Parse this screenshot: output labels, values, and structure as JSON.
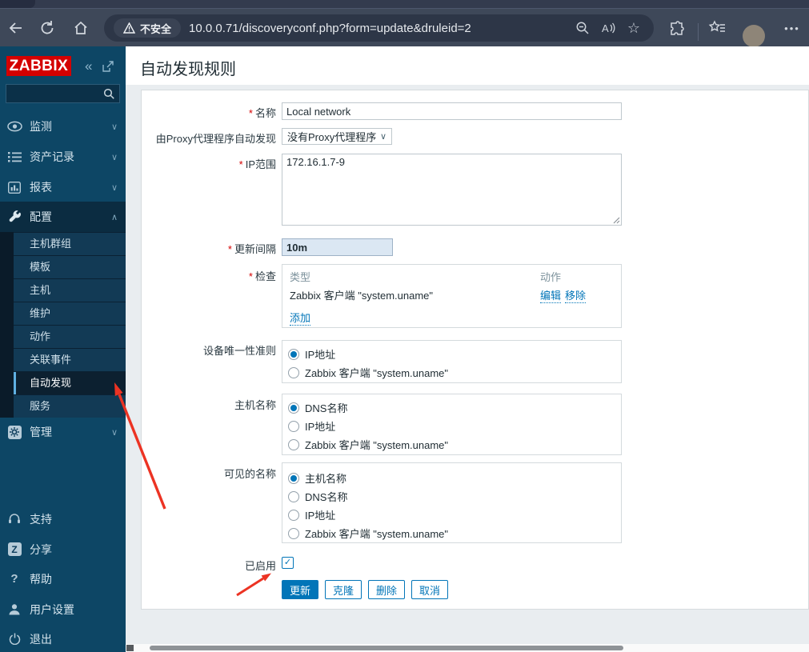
{
  "browser": {
    "security_badge": "不安全",
    "url": "10.0.0.71/discoveryconf.php?form=update&druleid=2"
  },
  "sidebar": {
    "logo": "ZABBIX",
    "menu": [
      {
        "label": "监测"
      },
      {
        "label": "资产记录"
      },
      {
        "label": "报表"
      },
      {
        "label": "配置"
      }
    ],
    "submenu": [
      "主机群组",
      "模板",
      "主机",
      "维护",
      "动作",
      "关联事件",
      "自动发现",
      "服务"
    ],
    "selected_submenu": "自动发现",
    "admin_label": "管理",
    "footer": [
      "支持",
      "分享",
      "帮助",
      "用户设置",
      "退出"
    ]
  },
  "page": {
    "title": "自动发现规则",
    "form": {
      "name": {
        "label": "名称",
        "value": "Local network",
        "required": true
      },
      "proxy": {
        "label": "由Proxy代理程序自动发现",
        "value": "没有Proxy代理程序"
      },
      "ip_range": {
        "label": "IP范围",
        "value": "172.16.1.7-9",
        "required": true
      },
      "interval": {
        "label": "更新间隔",
        "value": "10m",
        "required": true
      },
      "checks": {
        "label": "检查",
        "required": true,
        "type_header": "类型",
        "action_header": "动作",
        "row": "Zabbix 客户端 \"system.uname\"",
        "edit": "编辑",
        "remove": "移除",
        "add": "添加"
      },
      "uniqueness": {
        "label": "设备唯一性准则",
        "options": [
          {
            "label": "IP地址",
            "checked": true
          },
          {
            "label": "Zabbix 客户端 \"system.uname\"",
            "checked": false
          }
        ]
      },
      "hostname": {
        "label": "主机名称",
        "options": [
          {
            "label": "DNS名称",
            "checked": true
          },
          {
            "label": "IP地址",
            "checked": false
          },
          {
            "label": "Zabbix 客户端 \"system.uname\"",
            "checked": false
          }
        ]
      },
      "visible_name": {
        "label": "可见的名称",
        "options": [
          {
            "label": "主机名称",
            "checked": true
          },
          {
            "label": "DNS名称",
            "checked": false
          },
          {
            "label": "IP地址",
            "checked": false
          },
          {
            "label": "Zabbix 客户端 \"system.uname\"",
            "checked": false
          }
        ]
      },
      "enabled": {
        "label": "已启用",
        "checked": true
      },
      "buttons": {
        "update": "更新",
        "clone": "克隆",
        "delete": "删除",
        "cancel": "取消"
      }
    }
  },
  "glyphs": {
    "asterisk": "*",
    "collapse": "«",
    "chevron_down": "∨",
    "chevron_up": "∧",
    "help": "?",
    "share": "Z",
    "star": "☆",
    "dots": "•••",
    "check": "✓"
  },
  "colors": {
    "zabbix_red": "#d40000",
    "accent_blue": "#0275b8",
    "sidebar_navy": "#0d4665",
    "toolbar_gray": "#3e4859",
    "arrow_red": "#ec3323"
  }
}
